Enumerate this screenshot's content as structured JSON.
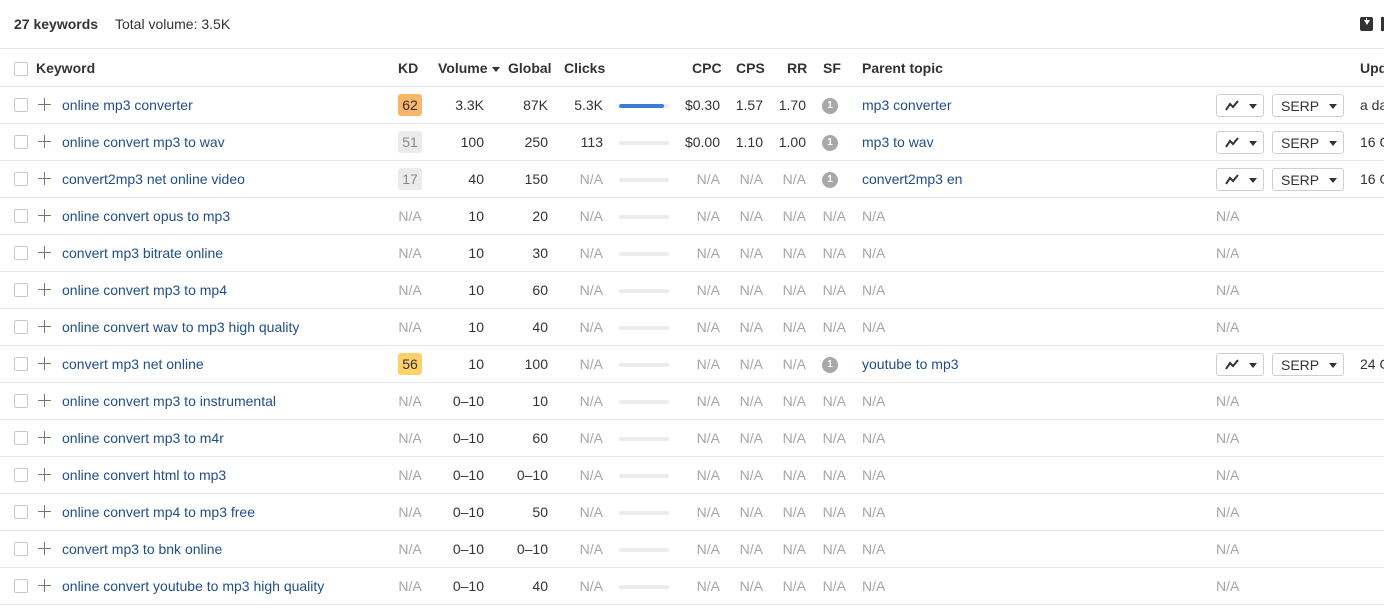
{
  "summary": {
    "keywords_count": "27 keywords",
    "total_volume": "Total volume: 3.5K"
  },
  "columns": {
    "keyword": "Keyword",
    "kd": "KD",
    "volume": "Volume",
    "global": "Global",
    "clicks": "Clicks",
    "cpc": "CPC",
    "cps": "CPS",
    "rr": "RR",
    "sf": "SF",
    "parent_topic": "Parent topic",
    "updated": "Upd"
  },
  "buttons": {
    "serp": "SERP"
  },
  "colors": {
    "link": "#1f4e8c",
    "kd_orange": "#f8b66a",
    "kd_yellow": "#fcd167",
    "kd_gray": "#ebebeb",
    "clicks_bar": "#3a7bd5"
  },
  "rows": [
    {
      "keyword": "online mp3 converter",
      "kd": "62",
      "kd_color": "orange",
      "volume": "3.3K",
      "global": "87K",
      "clicks": "5.3K",
      "clicks_bar": 0.9,
      "cpc": "$0.30",
      "cps": "1.57",
      "rr": "1.70",
      "sf": "1",
      "parent": "mp3 converter",
      "has_actions": true,
      "updated": "a da"
    },
    {
      "keyword": "online convert mp3 to wav",
      "kd": "51",
      "kd_color": "gray",
      "volume": "100",
      "global": "250",
      "clicks": "113",
      "clicks_bar": 0,
      "cpc": "$0.00",
      "cps": "1.10",
      "rr": "1.00",
      "sf": "1",
      "parent": "mp3 to wav",
      "has_actions": true,
      "updated": "16 O"
    },
    {
      "keyword": "convert2mp3 net online video",
      "kd": "17",
      "kd_color": "gray",
      "volume": "40",
      "global": "150",
      "clicks": "N/A",
      "clicks_bar": 0,
      "cpc": "N/A",
      "cps": "N/A",
      "rr": "N/A",
      "sf": "1",
      "parent": "convert2mp3 en",
      "has_actions": true,
      "updated": "16 O"
    },
    {
      "keyword": "online convert opus to mp3",
      "kd": "N/A",
      "kd_color": "none",
      "volume": "10",
      "global": "20",
      "clicks": "N/A",
      "clicks_bar": 0,
      "cpc": "N/A",
      "cps": "N/A",
      "rr": "N/A",
      "sf": "N/A",
      "parent": "N/A",
      "has_actions": false,
      "updated": ""
    },
    {
      "keyword": "convert mp3 bitrate online",
      "kd": "N/A",
      "kd_color": "none",
      "volume": "10",
      "global": "30",
      "clicks": "N/A",
      "clicks_bar": 0,
      "cpc": "N/A",
      "cps": "N/A",
      "rr": "N/A",
      "sf": "N/A",
      "parent": "N/A",
      "has_actions": false,
      "updated": ""
    },
    {
      "keyword": "online convert mp3 to mp4",
      "kd": "N/A",
      "kd_color": "none",
      "volume": "10",
      "global": "60",
      "clicks": "N/A",
      "clicks_bar": 0,
      "cpc": "N/A",
      "cps": "N/A",
      "rr": "N/A",
      "sf": "N/A",
      "parent": "N/A",
      "has_actions": false,
      "updated": ""
    },
    {
      "keyword": "online convert wav to mp3 high quality",
      "kd": "N/A",
      "kd_color": "none",
      "volume": "10",
      "global": "40",
      "clicks": "N/A",
      "clicks_bar": 0,
      "cpc": "N/A",
      "cps": "N/A",
      "rr": "N/A",
      "sf": "N/A",
      "parent": "N/A",
      "has_actions": false,
      "updated": ""
    },
    {
      "keyword": "convert mp3 net online",
      "kd": "56",
      "kd_color": "yellow",
      "volume": "10",
      "global": "100",
      "clicks": "N/A",
      "clicks_bar": 0,
      "cpc": "N/A",
      "cps": "N/A",
      "rr": "N/A",
      "sf": "1",
      "parent": "youtube to mp3",
      "has_actions": true,
      "updated": "24 O"
    },
    {
      "keyword": "online convert mp3 to instrumental",
      "kd": "N/A",
      "kd_color": "none",
      "volume": "0–10",
      "global": "10",
      "clicks": "N/A",
      "clicks_bar": 0,
      "cpc": "N/A",
      "cps": "N/A",
      "rr": "N/A",
      "sf": "N/A",
      "parent": "N/A",
      "has_actions": false,
      "updated": ""
    },
    {
      "keyword": "online convert mp3 to m4r",
      "kd": "N/A",
      "kd_color": "none",
      "volume": "0–10",
      "global": "60",
      "clicks": "N/A",
      "clicks_bar": 0,
      "cpc": "N/A",
      "cps": "N/A",
      "rr": "N/A",
      "sf": "N/A",
      "parent": "N/A",
      "has_actions": false,
      "updated": ""
    },
    {
      "keyword": "online convert html to mp3",
      "kd": "N/A",
      "kd_color": "none",
      "volume": "0–10",
      "global": "0–10",
      "clicks": "N/A",
      "clicks_bar": 0,
      "cpc": "N/A",
      "cps": "N/A",
      "rr": "N/A",
      "sf": "N/A",
      "parent": "N/A",
      "has_actions": false,
      "updated": ""
    },
    {
      "keyword": "online convert mp4 to mp3 free",
      "kd": "N/A",
      "kd_color": "none",
      "volume": "0–10",
      "global": "50",
      "clicks": "N/A",
      "clicks_bar": 0,
      "cpc": "N/A",
      "cps": "N/A",
      "rr": "N/A",
      "sf": "N/A",
      "parent": "N/A",
      "has_actions": false,
      "updated": ""
    },
    {
      "keyword": "convert mp3 to bnk online",
      "kd": "N/A",
      "kd_color": "none",
      "volume": "0–10",
      "global": "0–10",
      "clicks": "N/A",
      "clicks_bar": 0,
      "cpc": "N/A",
      "cps": "N/A",
      "rr": "N/A",
      "sf": "N/A",
      "parent": "N/A",
      "has_actions": false,
      "updated": ""
    },
    {
      "keyword": "online convert youtube to mp3 high quality",
      "kd": "N/A",
      "kd_color": "none",
      "volume": "0–10",
      "global": "40",
      "clicks": "N/A",
      "clicks_bar": 0,
      "cpc": "N/A",
      "cps": "N/A",
      "rr": "N/A",
      "sf": "N/A",
      "parent": "N/A",
      "has_actions": false,
      "updated": ""
    }
  ]
}
